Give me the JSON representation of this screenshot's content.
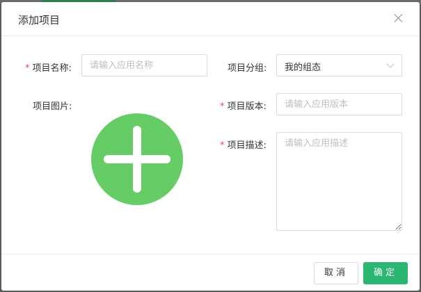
{
  "dialog": {
    "title": "添加项目",
    "close_icon": "close-icon"
  },
  "form": {
    "name": {
      "required": "*",
      "label": "项目名称:",
      "placeholder": "请输入应用名称",
      "value": ""
    },
    "group": {
      "label": "项目分组:",
      "value": "我的组态"
    },
    "image": {
      "label": "项目图片:",
      "icon": "plus-icon",
      "color": "#66cc66"
    },
    "version": {
      "required": "*",
      "label": "项目版本:",
      "placeholder": "请输入应用版本",
      "value": ""
    },
    "description": {
      "required": "*",
      "label": "项目描述:",
      "placeholder": "请输入应用描述",
      "value": ""
    }
  },
  "footer": {
    "cancel_label": "取消",
    "ok_label": "确定"
  },
  "colors": {
    "primary": "#2bb673",
    "required": "#e5484d"
  }
}
